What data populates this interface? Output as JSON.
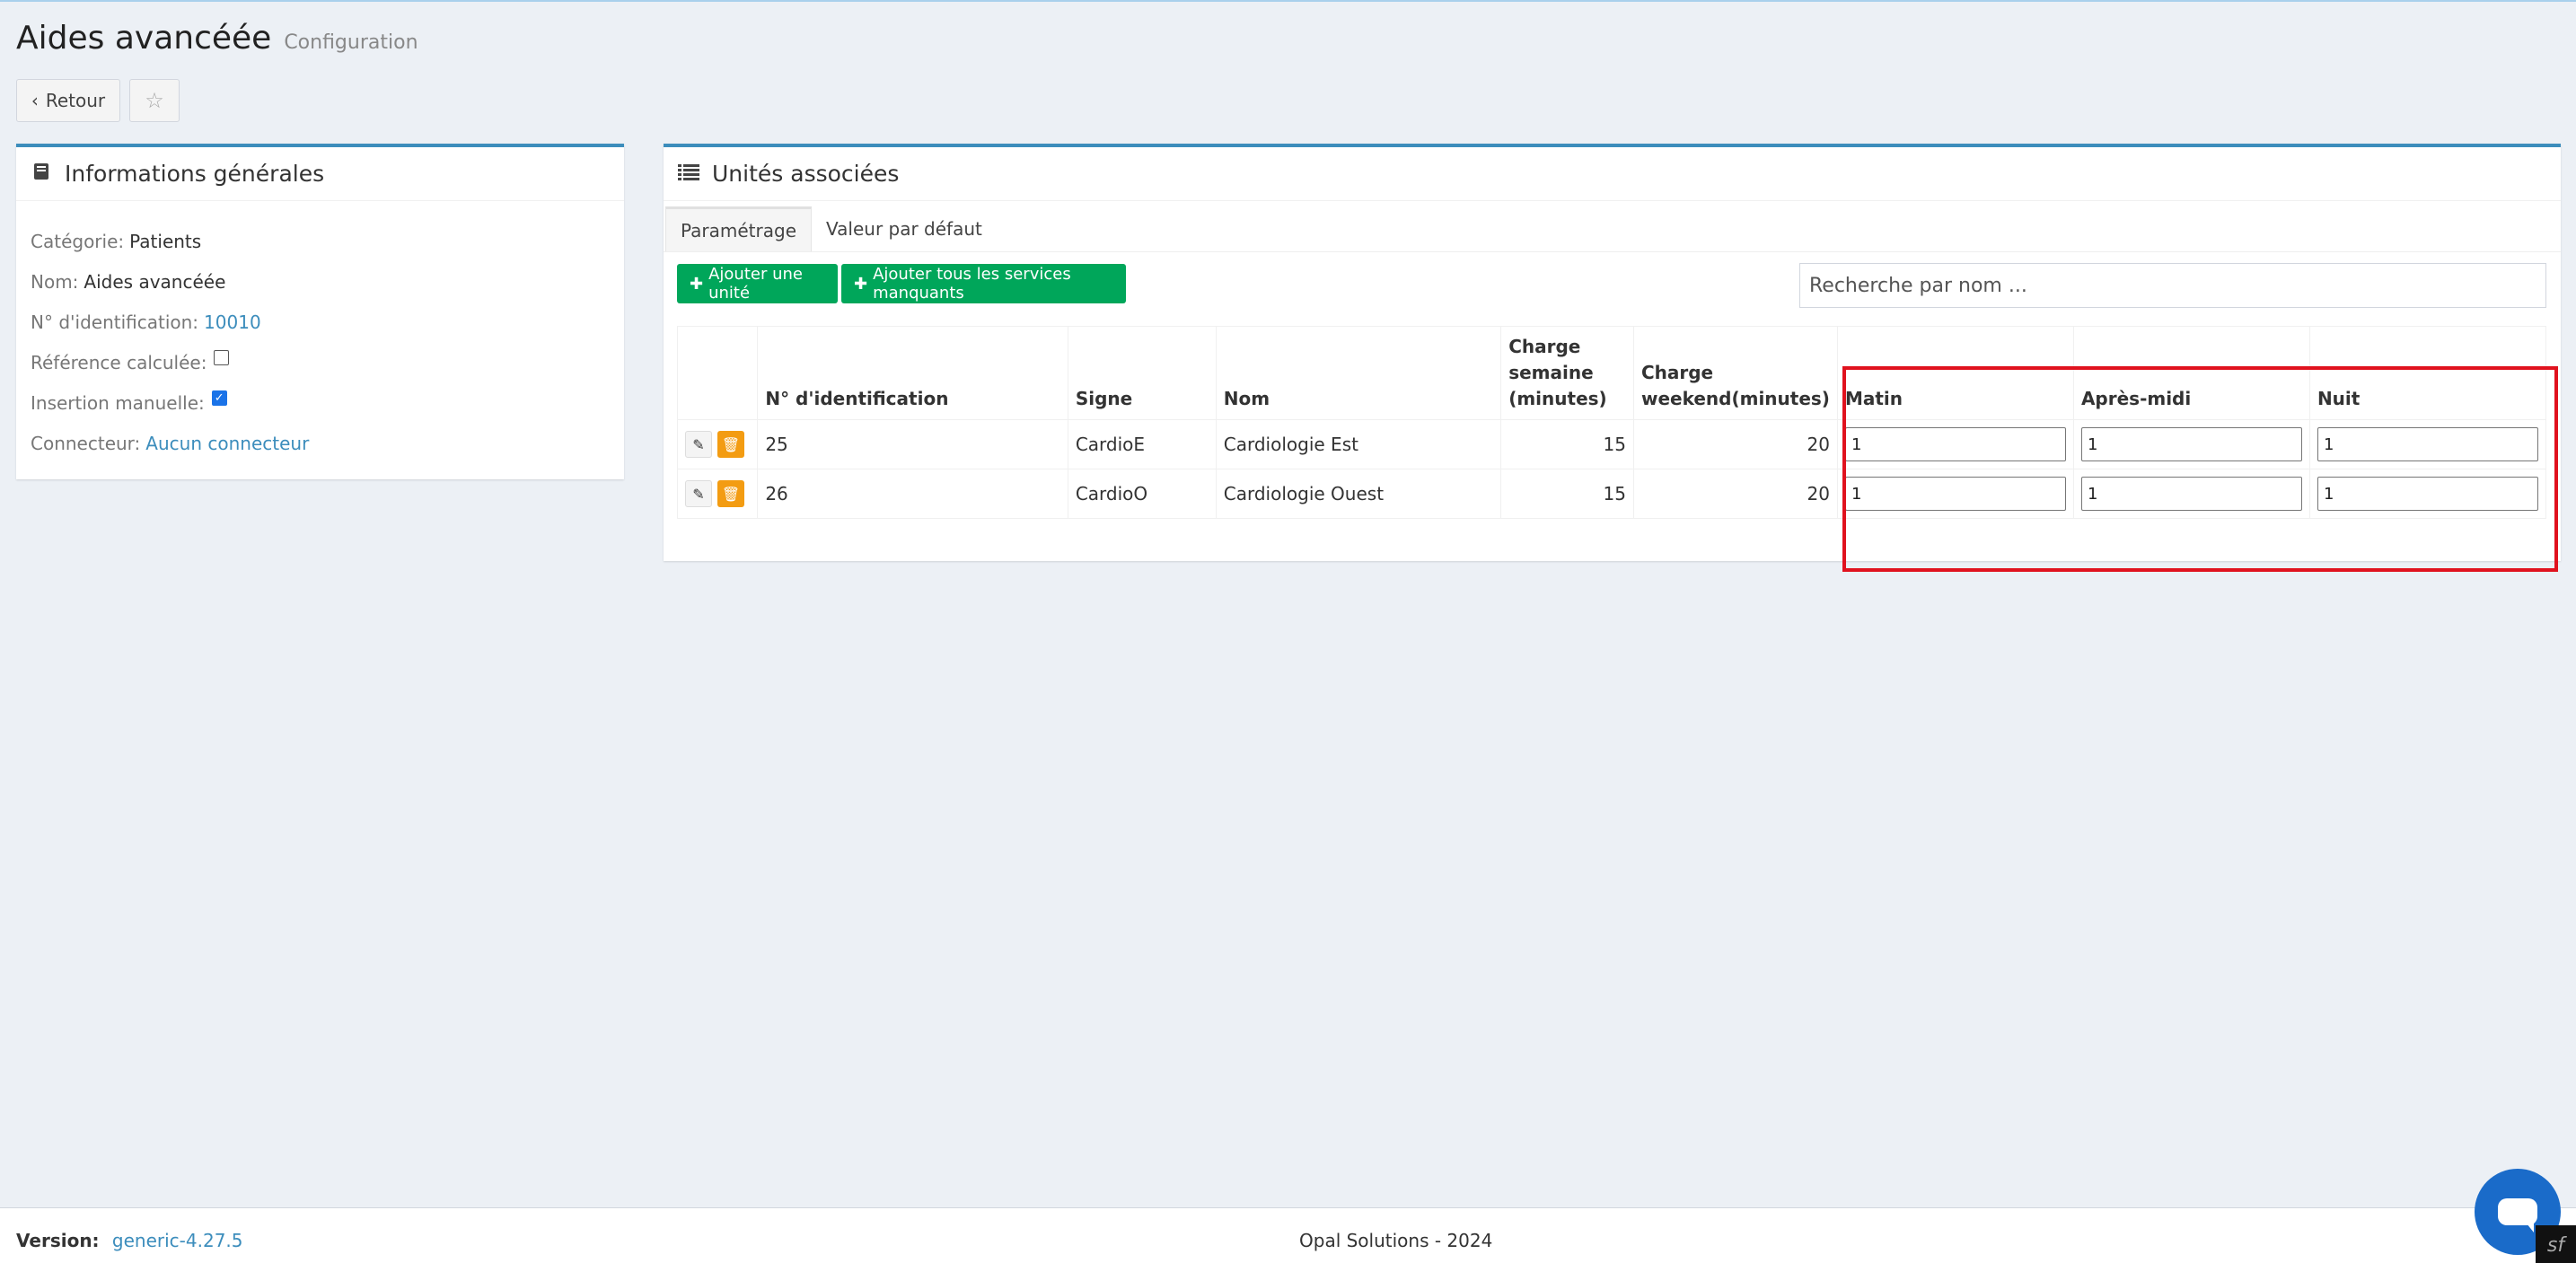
{
  "header": {
    "title": "Aides avancéée",
    "subtitle": "Configuration"
  },
  "toolbar": {
    "back_icon": "chevron-left-icon",
    "back_label": "Retour",
    "star_icon": "star-icon"
  },
  "general": {
    "title": "Informations générales",
    "icon": "book-icon",
    "category_label": "Catégorie:",
    "category_value": "Patients",
    "name_label": "Nom:",
    "name_value": "Aides avancéée",
    "id_label": "N° d'identification:",
    "id_value": "10010",
    "calc_ref_label": "Référence calculée:",
    "calc_ref_checked": false,
    "manual_label": "Insertion manuelle:",
    "manual_checked": true,
    "connector_label": "Connecteur:",
    "connector_value": "Aucun connecteur"
  },
  "units": {
    "title": "Unités associées",
    "icon": "list-icon",
    "tabs": [
      "Paramétrage",
      "Valeur par défaut"
    ],
    "active_tab": 0,
    "add_unit_label": "Ajouter une unité",
    "add_all_label": "Ajouter tous les services manquants",
    "search_placeholder": "Recherche par nom ...",
    "columns": [
      "",
      "N° d'identification",
      "Signe",
      "Nom",
      "Charge semaine (minutes)",
      "Charge weekend(minutes)",
      "Matin",
      "Après-midi",
      "Nuit"
    ],
    "rows": [
      {
        "id": "25",
        "sign": "CardioE",
        "name": "Cardiologie Est",
        "week": "15",
        "weekend": "20",
        "matin": "1",
        "apres_midi": "1",
        "nuit": "1"
      },
      {
        "id": "26",
        "sign": "CardioO",
        "name": "Cardiologie Ouest",
        "week": "15",
        "weekend": "20",
        "matin": "1",
        "apres_midi": "1",
        "nuit": "1"
      }
    ],
    "highlight_color": "#e0121e"
  },
  "footer": {
    "version_label": "Version:",
    "version_value": "generic-4.27.5",
    "copyright": "Opal Solutions - 2024"
  },
  "chat": {
    "icon": "chat-bubble-icon"
  }
}
